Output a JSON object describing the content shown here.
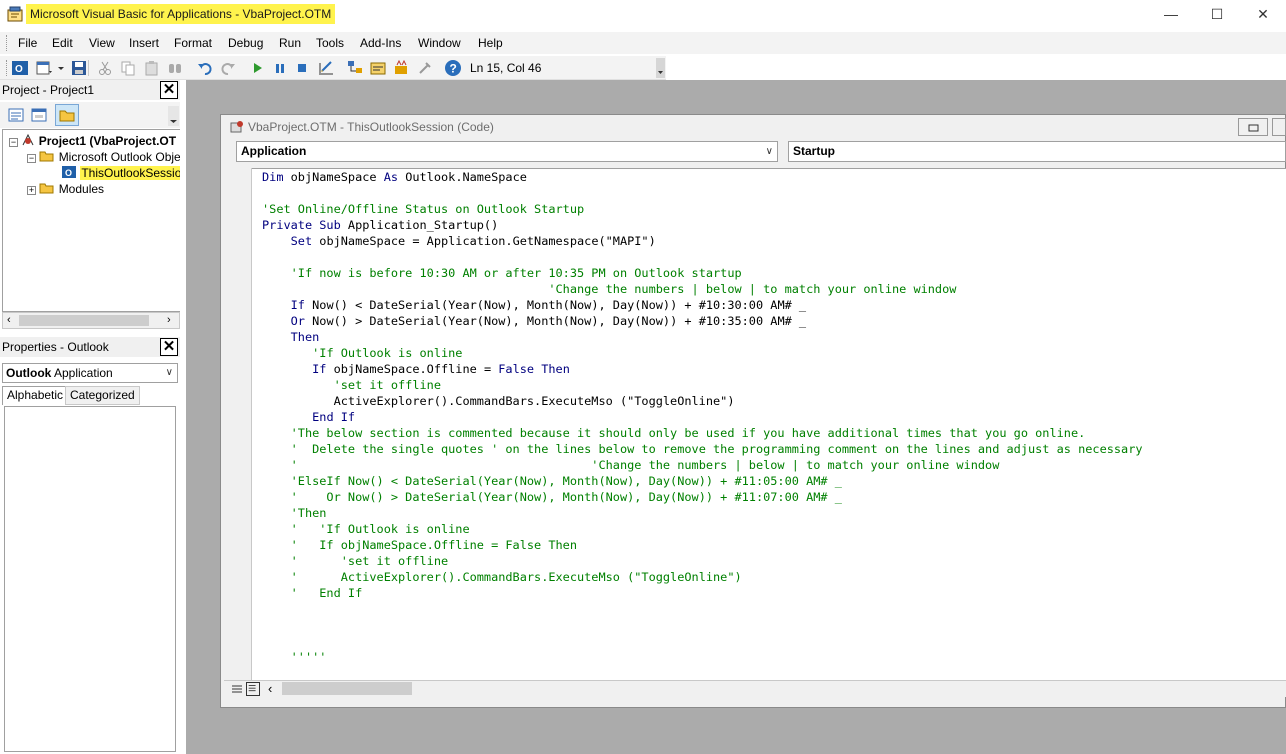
{
  "window": {
    "title": "Microsoft Visual Basic for Applications - VbaProject.OTM",
    "minimize_glyph": "—",
    "maximize_glyph": "☐",
    "close_glyph": "✕"
  },
  "menu": [
    "File",
    "Edit",
    "View",
    "Insert",
    "Format",
    "Debug",
    "Run",
    "Tools",
    "Add-Ins",
    "Window",
    "Help"
  ],
  "toolbar": {
    "icons": [
      "outlook-icon",
      "insert-userform-icon",
      "save-icon",
      "cut-icon",
      "copy-icon",
      "paste-icon",
      "find-icon",
      "undo-icon",
      "redo-icon",
      "run-icon",
      "break-icon",
      "reset-icon",
      "design-mode-icon",
      "project-explorer-icon",
      "properties-icon",
      "object-browser-icon",
      "toolbox-icon",
      "help-icon"
    ],
    "cursor_position": "Ln 15, Col 46"
  },
  "project_pane": {
    "title": "Project - Project1",
    "close_glyph": "✕",
    "tree": [
      {
        "label": "Project1 (VbaProject.OT",
        "expander": "−",
        "bold": true
      },
      {
        "label": "Microsoft Outlook Objec",
        "expander": "−",
        "bold": false
      },
      {
        "label": "ThisOutlookSession",
        "expander": "",
        "bold": false,
        "selected": true
      },
      {
        "label": "Modules",
        "expander": "+",
        "bold": false
      }
    ]
  },
  "properties_pane": {
    "title": "Properties - Outlook",
    "close_glyph": "✕",
    "object_name": "Outlook",
    "object_type": "Application",
    "tabs": [
      "Alphabetic",
      "Categorized"
    ],
    "active_tab": "Alphabetic"
  },
  "code_window": {
    "title": "VbaProject.OTM - ThisOutlookSession (Code)",
    "object_combo": "Application",
    "procedure_combo": "Startup",
    "lines": [
      [
        {
          "t": "kw",
          "v": "Dim"
        },
        {
          "t": "n",
          "v": " objNameSpace "
        },
        {
          "t": "kw",
          "v": "As"
        },
        {
          "t": "n",
          "v": " Outlook.NameSpace"
        }
      ],
      [],
      [
        {
          "t": "cm",
          "v": "'Set Online/Offline Status on Outlook Startup"
        }
      ],
      [
        {
          "t": "kw",
          "v": "Private Sub"
        },
        {
          "t": "n",
          "v": " Application_Startup()"
        }
      ],
      [
        {
          "t": "n",
          "v": "    "
        },
        {
          "t": "kw",
          "v": "Set"
        },
        {
          "t": "n",
          "v": " objNameSpace = Application.GetNamespace(\"MAPI\")"
        }
      ],
      [],
      [
        {
          "t": "n",
          "v": "    "
        },
        {
          "t": "cm",
          "v": "'If now is before 10:30 AM or after 10:35 PM on Outlook startup"
        }
      ],
      [
        {
          "t": "n",
          "v": "                                        "
        },
        {
          "t": "cm",
          "v": "'Change the numbers | below | to match your online window"
        }
      ],
      [
        {
          "t": "n",
          "v": "    "
        },
        {
          "t": "kw",
          "v": "If"
        },
        {
          "t": "n",
          "v": " Now() < DateSerial(Year(Now), Month(Now), Day(Now)) + #10:30:00 AM# _"
        }
      ],
      [
        {
          "t": "n",
          "v": "    "
        },
        {
          "t": "kw",
          "v": "Or"
        },
        {
          "t": "n",
          "v": " Now() > DateSerial(Year(Now), Month(Now), Day(Now)) + #10:35:00 AM# _"
        }
      ],
      [
        {
          "t": "n",
          "v": "    "
        },
        {
          "t": "kw",
          "v": "Then"
        }
      ],
      [
        {
          "t": "n",
          "v": "       "
        },
        {
          "t": "cm",
          "v": "'If Outlook is online"
        }
      ],
      [
        {
          "t": "n",
          "v": "       "
        },
        {
          "t": "kw",
          "v": "If"
        },
        {
          "t": "n",
          "v": " objNameSpace.Offline = "
        },
        {
          "t": "kw",
          "v": "False Then"
        }
      ],
      [
        {
          "t": "n",
          "v": "          "
        },
        {
          "t": "cm",
          "v": "'set it offline"
        }
      ],
      [
        {
          "t": "n",
          "v": "          ActiveExplorer().CommandBars.ExecuteMso (\"ToggleOnline\")"
        }
      ],
      [
        {
          "t": "n",
          "v": "       "
        },
        {
          "t": "kw",
          "v": "End If"
        }
      ],
      [
        {
          "t": "n",
          "v": "    "
        },
        {
          "t": "cm",
          "v": "'The below section is commented because it should only be used if you have additional times that you go online."
        }
      ],
      [
        {
          "t": "n",
          "v": "    "
        },
        {
          "t": "cm",
          "v": "'  Delete the single quotes ' on the lines below to remove the programming comment on the lines and adjust as necessary"
        }
      ],
      [
        {
          "t": "n",
          "v": "    "
        },
        {
          "t": "cm",
          "v": "'                                         'Change the numbers | below | to match your online window"
        }
      ],
      [
        {
          "t": "n",
          "v": "    "
        },
        {
          "t": "cm",
          "v": "'ElseIf Now() < DateSerial(Year(Now), Month(Now), Day(Now)) + #11:05:00 AM# _"
        }
      ],
      [
        {
          "t": "n",
          "v": "    "
        },
        {
          "t": "cm",
          "v": "'    Or Now() > DateSerial(Year(Now), Month(Now), Day(Now)) + #11:07:00 AM# _"
        }
      ],
      [
        {
          "t": "n",
          "v": "    "
        },
        {
          "t": "cm",
          "v": "'Then"
        }
      ],
      [
        {
          "t": "n",
          "v": "    "
        },
        {
          "t": "cm",
          "v": "'   'If Outlook is online"
        }
      ],
      [
        {
          "t": "n",
          "v": "    "
        },
        {
          "t": "cm",
          "v": "'   If objNameSpace.Offline = False Then"
        }
      ],
      [
        {
          "t": "n",
          "v": "    "
        },
        {
          "t": "cm",
          "v": "'      'set it offline"
        }
      ],
      [
        {
          "t": "n",
          "v": "    "
        },
        {
          "t": "cm",
          "v": "'      ActiveExplorer().CommandBars.ExecuteMso (\"ToggleOnline\")"
        }
      ],
      [
        {
          "t": "n",
          "v": "    "
        },
        {
          "t": "cm",
          "v": "'   End If"
        }
      ],
      [],
      [],
      [],
      [
        {
          "t": "n",
          "v": "    "
        },
        {
          "t": "cm",
          "v": "'''''"
        }
      ]
    ]
  },
  "colors": {
    "title_highlight": "#fff34d",
    "keyword": "#00007f",
    "comment": "#008000",
    "selection": "#fff34d",
    "mdi_background": "#ababab"
  }
}
